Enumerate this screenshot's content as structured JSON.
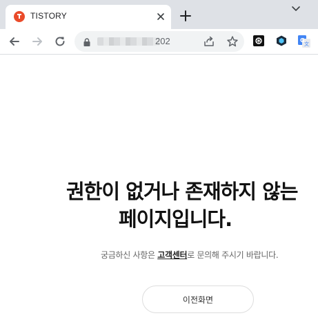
{
  "browser": {
    "tab": {
      "title": "TISTORY",
      "favicon_color": "#ea4b2a"
    },
    "address": {
      "url_visible_suffix": "202"
    },
    "icons": {
      "tab_close": "close-icon",
      "new_tab": "plus-icon",
      "tab_list": "chevron-down-icon",
      "back": "arrow-left-icon",
      "forward": "arrow-right-icon",
      "reload": "reload-icon",
      "lock": "lock-icon",
      "share": "share-icon",
      "bookmark": "star-icon"
    },
    "extensions": [
      "openai-extension-icon",
      "dark-extension-icon",
      "google-translate-icon"
    ]
  },
  "page": {
    "headline_line1": "권한이 없거나 존재하지 않는",
    "headline_line2": "페이지입니다.",
    "subtext_before": "궁금하신 사항은 ",
    "subtext_link": "고객센터",
    "subtext_after": "로 문의해 주시기 바랍니다.",
    "back_button": "이전화면"
  },
  "colors": {
    "tabstrip_bg": "#dee1e6",
    "omnibox_bg": "#f1f3f4",
    "headline": "#111111",
    "subtext": "#666666"
  }
}
